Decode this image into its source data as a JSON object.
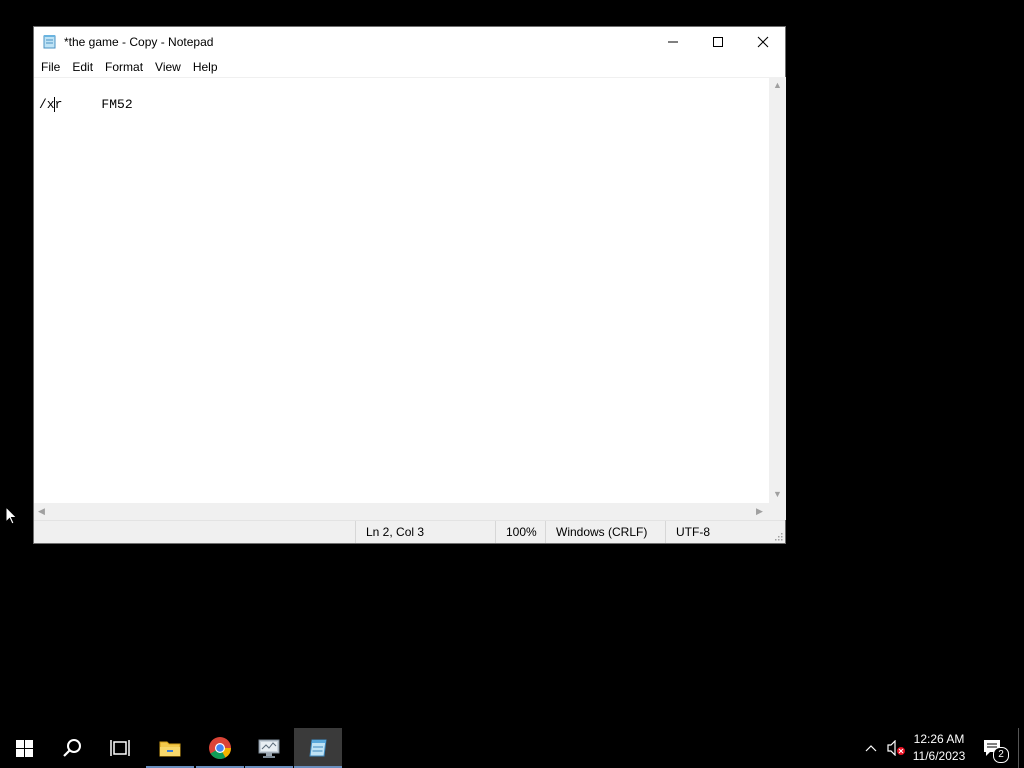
{
  "window": {
    "title": "*the game - Copy - Notepad"
  },
  "menu": {
    "items": [
      "File",
      "Edit",
      "Format",
      "View",
      "Help"
    ]
  },
  "document": {
    "lines": [
      "",
      "/xr     FM52"
    ]
  },
  "status": {
    "position": "Ln 2, Col 3",
    "zoom": "100%",
    "line_endings": "Windows (CRLF)",
    "encoding": "UTF-8"
  },
  "taskbar": {
    "apps": [
      {
        "name": "start",
        "icon": "windows-logo-icon"
      },
      {
        "name": "search",
        "icon": "search-icon"
      },
      {
        "name": "task-view",
        "icon": "task-view-icon"
      },
      {
        "name": "file-explorer",
        "icon": "folder-icon"
      },
      {
        "name": "chrome",
        "icon": "chrome-icon"
      },
      {
        "name": "app",
        "icon": "monitor-app-icon"
      },
      {
        "name": "notepad",
        "icon": "notepad-icon",
        "active": true
      }
    ],
    "clock": {
      "time": "12:26 AM",
      "date": "11/6/2023"
    },
    "notification_count": "2"
  },
  "colors": {
    "desktop": "#000000",
    "window_bg": "#ffffff",
    "statusbar_bg": "#f0f0f0",
    "taskbar_active": "#3a3a3a",
    "taskbar_underline": "#6a8fbf"
  }
}
